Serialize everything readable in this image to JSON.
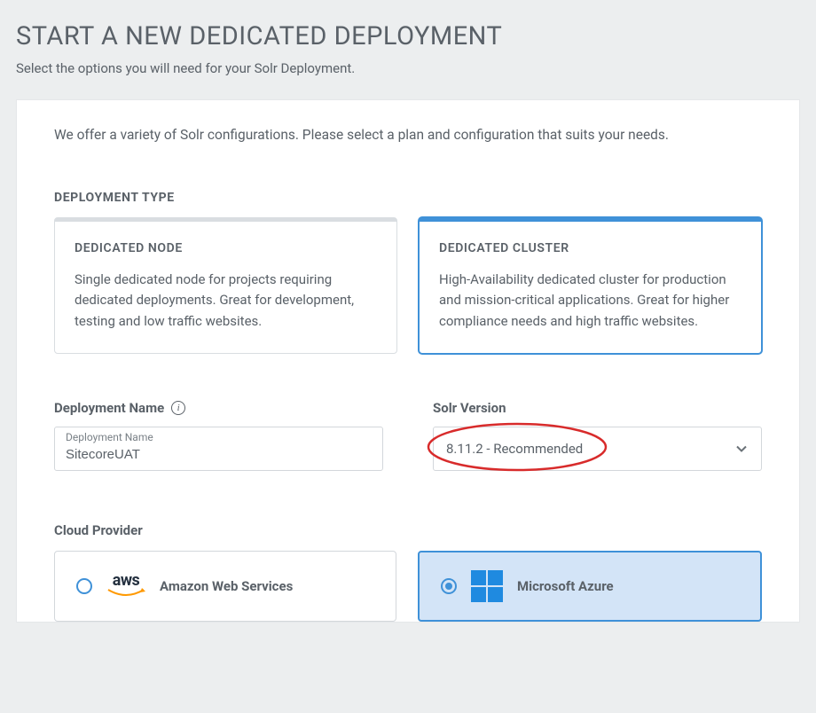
{
  "header": {
    "title": "START A NEW DEDICATED DEPLOYMENT",
    "subtitle": "Select the options you will need for your Solr Deployment."
  },
  "intro": "We offer a variety of Solr configurations. Please select a plan and configuration that suits your needs.",
  "deployment_type": {
    "label": "DEPLOYMENT TYPE",
    "options": [
      {
        "title": "DEDICATED NODE",
        "desc": "Single dedicated node for projects requiring dedicated deployments. Great for development, testing and low traffic websites.",
        "selected": false
      },
      {
        "title": "DEDICATED CLUSTER",
        "desc": "High-Availability dedicated cluster for production and mission-critical applications. Great for higher compliance needs and high traffic websites.",
        "selected": true
      }
    ]
  },
  "deployment_name": {
    "label": "Deployment Name",
    "floating_label": "Deployment Name",
    "value": "SitecoreUAT"
  },
  "solr_version": {
    "label": "Solr Version",
    "selected": "8.11.2 - Recommended"
  },
  "cloud_provider": {
    "label": "Cloud Provider",
    "options": [
      {
        "name": "Amazon Web Services",
        "selected": false
      },
      {
        "name": "Microsoft Azure",
        "selected": true
      }
    ]
  }
}
